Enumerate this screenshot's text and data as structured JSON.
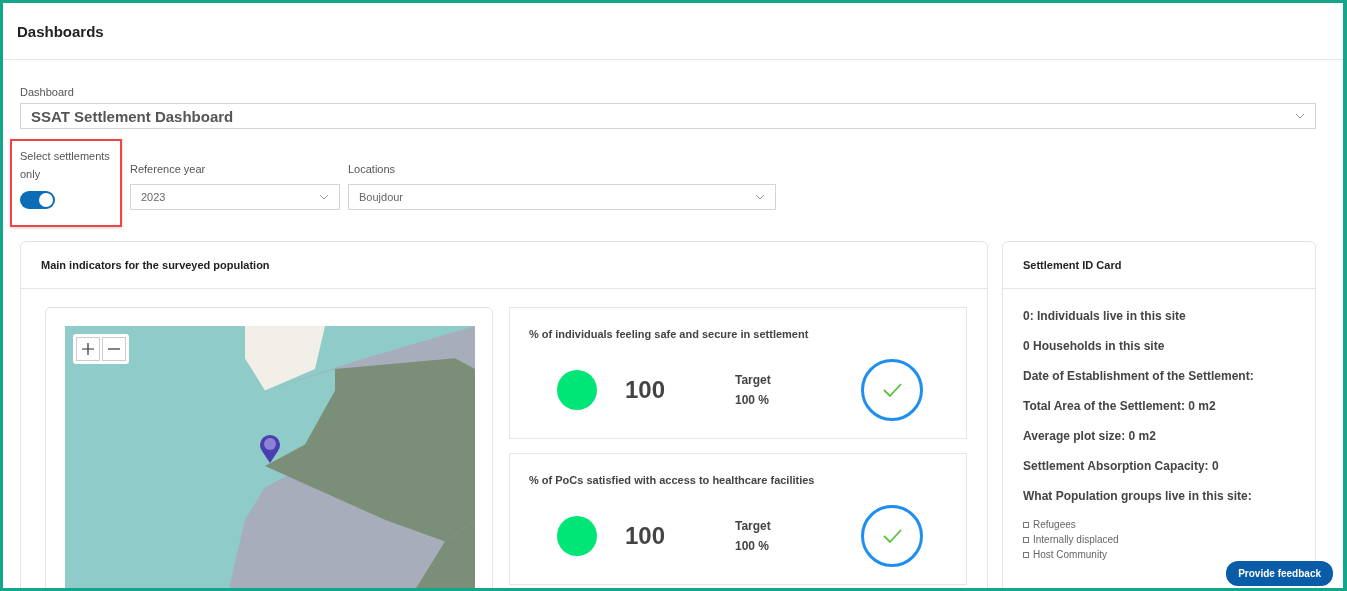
{
  "page": {
    "title": "Dashboards"
  },
  "dashboard_select": {
    "label": "Dashboard",
    "value": "SSAT Settlement Dashboard"
  },
  "filters": {
    "settlements_toggle": {
      "label": "Select settlements only",
      "on": true,
      "highlighted": true
    },
    "reference_year": {
      "label": "Reference year",
      "value": "2023"
    },
    "locations": {
      "label": "Locations",
      "value": "Boujdour"
    }
  },
  "main_panel": {
    "title": "Main indicators for the surveyed population",
    "indicators": [
      {
        "title": "% of individuals feeling safe and secure in settlement",
        "value": "100",
        "color": "#00e676",
        "target_label": "Target",
        "target": "100 %",
        "met": true
      },
      {
        "title": "% of PoCs satisfied with access to healthcare facilities",
        "value": "100",
        "color": "#00e676",
        "target_label": "Target",
        "target": "100 %",
        "met": true
      }
    ]
  },
  "id_card": {
    "title": "Settlement ID Card",
    "facts": [
      "0: Individuals live in this site",
      "0 Households in this site",
      "Date of Establishment of the Settlement:",
      "Total Area of the Settlement: 0 m2",
      "Average plot size: 0 m2",
      "Settlement Absorption Capacity: 0",
      "What Population groups live in this site:"
    ],
    "population_groups": [
      {
        "label": "Refugees",
        "checked": false
      },
      {
        "label": "Internally displaced",
        "checked": false
      },
      {
        "label": "Host Community",
        "checked": false
      }
    ]
  },
  "feedback_button": {
    "label": "Provide feedback"
  }
}
